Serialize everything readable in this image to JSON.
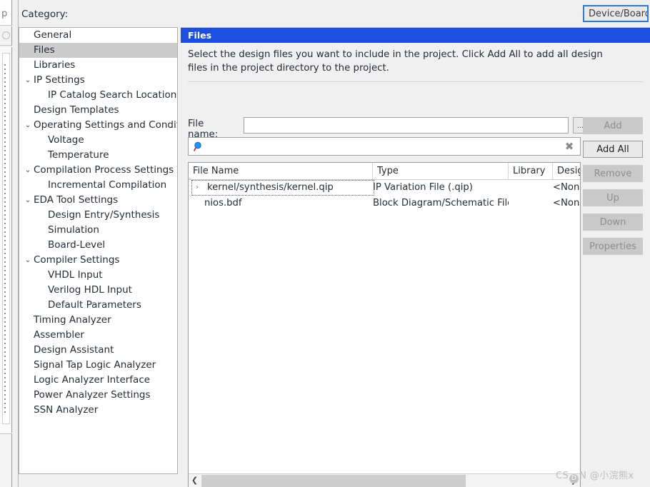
{
  "category": {
    "label": "Category:",
    "items": [
      {
        "label": "General",
        "level": 0,
        "twisty": "",
        "selected": false
      },
      {
        "label": "Files",
        "level": 0,
        "twisty": "",
        "selected": true
      },
      {
        "label": "Libraries",
        "level": 0,
        "twisty": "",
        "selected": false
      },
      {
        "label": "IP Settings",
        "level": 0,
        "twisty": "⌄",
        "selected": false
      },
      {
        "label": "IP Catalog Search Locations",
        "level": 1,
        "twisty": "",
        "selected": false
      },
      {
        "label": "Design Templates",
        "level": 0,
        "twisty": "",
        "selected": false
      },
      {
        "label": "Operating Settings and Conditio",
        "level": 0,
        "twisty": "⌄",
        "selected": false
      },
      {
        "label": "Voltage",
        "level": 1,
        "twisty": "",
        "selected": false
      },
      {
        "label": "Temperature",
        "level": 1,
        "twisty": "",
        "selected": false
      },
      {
        "label": "Compilation Process Settings",
        "level": 0,
        "twisty": "⌄",
        "selected": false
      },
      {
        "label": "Incremental Compilation",
        "level": 1,
        "twisty": "",
        "selected": false
      },
      {
        "label": "EDA Tool Settings",
        "level": 0,
        "twisty": "⌄",
        "selected": false
      },
      {
        "label": "Design Entry/Synthesis",
        "level": 1,
        "twisty": "",
        "selected": false
      },
      {
        "label": "Simulation",
        "level": 1,
        "twisty": "",
        "selected": false
      },
      {
        "label": "Board-Level",
        "level": 1,
        "twisty": "",
        "selected": false
      },
      {
        "label": "Compiler Settings",
        "level": 0,
        "twisty": "⌄",
        "selected": false
      },
      {
        "label": "VHDL Input",
        "level": 1,
        "twisty": "",
        "selected": false
      },
      {
        "label": "Verilog HDL Input",
        "level": 1,
        "twisty": "",
        "selected": false
      },
      {
        "label": "Default Parameters",
        "level": 1,
        "twisty": "",
        "selected": false
      },
      {
        "label": "Timing Analyzer",
        "level": 0,
        "twisty": "",
        "selected": false
      },
      {
        "label": "Assembler",
        "level": 0,
        "twisty": "",
        "selected": false
      },
      {
        "label": "Design Assistant",
        "level": 0,
        "twisty": "",
        "selected": false
      },
      {
        "label": "Signal Tap Logic Analyzer",
        "level": 0,
        "twisty": "",
        "selected": false
      },
      {
        "label": "Logic Analyzer Interface",
        "level": 0,
        "twisty": "",
        "selected": false
      },
      {
        "label": "Power Analyzer Settings",
        "level": 0,
        "twisty": "",
        "selected": false
      },
      {
        "label": "SSN Analyzer",
        "level": 0,
        "twisty": "",
        "selected": false
      }
    ]
  },
  "panel": {
    "title": "Files",
    "title_bg": "#1c4fe0",
    "description": "Select the design files you want to include in the project. Click Add All to add all design files in the project directory to the project.",
    "file_name_label": "File name:",
    "file_name_value": "",
    "browse_label": "...",
    "search_value": "",
    "search_clear_label": "✖"
  },
  "buttons": [
    {
      "key": "add",
      "label": "Add",
      "enabled": false
    },
    {
      "key": "add_all",
      "label": "Add All",
      "enabled": true
    },
    {
      "key": "remove",
      "label": "Remove",
      "enabled": false
    },
    {
      "key": "up",
      "label": "Up",
      "enabled": false
    },
    {
      "key": "down",
      "label": "Down",
      "enabled": false
    },
    {
      "key": "properties",
      "label": "Properties",
      "enabled": false
    }
  ],
  "table": {
    "columns": [
      "File Name",
      "Type",
      "Library",
      "Design"
    ],
    "rows": [
      {
        "file_name": "kernel/synthesis/kernel.qip",
        "type": "IP Variation File (.qip)",
        "library": "",
        "design": "<None>",
        "expandable": true,
        "expander": "›",
        "focused": true
      },
      {
        "file_name": "nios.bdf",
        "type": "Block Diagram/Schematic File",
        "library": "",
        "design": "<None>",
        "expandable": false,
        "expander": "",
        "focused": false
      }
    ],
    "scroll_left_arrow": "❮",
    "scroll_right_arrow": "❯"
  },
  "toolbar": {
    "device_board_label": "Device/Board..."
  },
  "watermark": {
    "prefix": "CS",
    "mark": "D",
    "suffix": "N @小浣熊x"
  }
}
